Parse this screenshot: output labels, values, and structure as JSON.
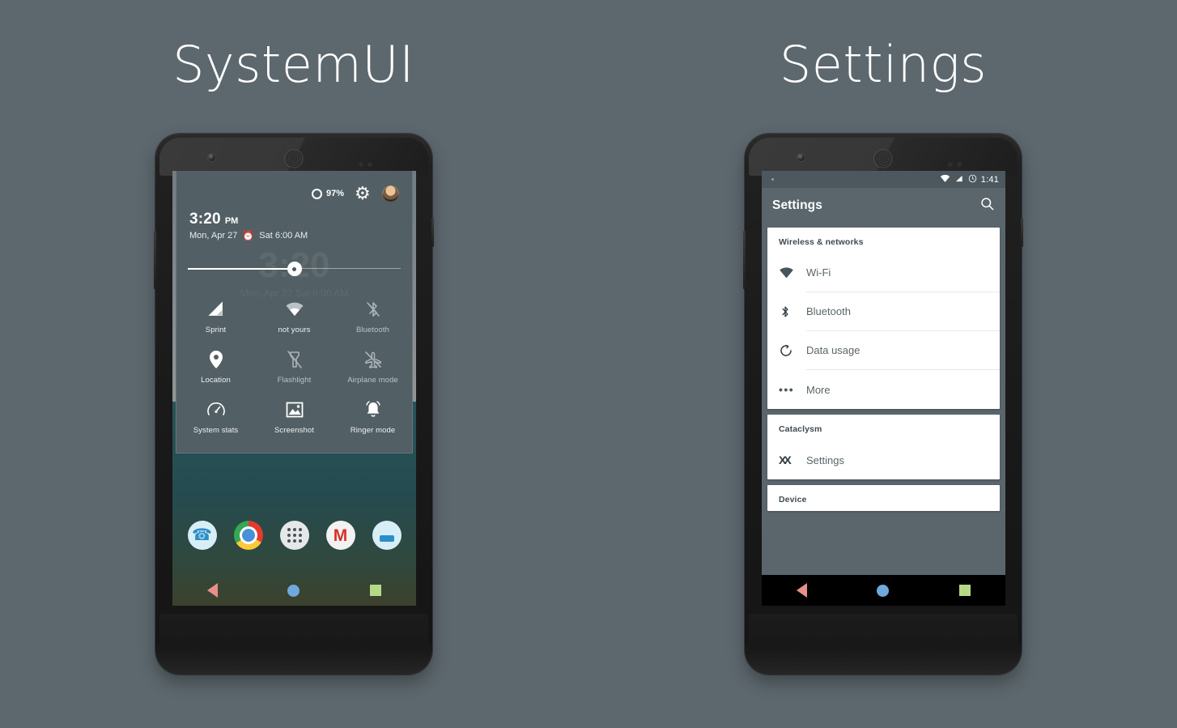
{
  "page": {
    "background_color": "#5d686e",
    "titles": {
      "left": "SystemUI",
      "right": "Settings"
    }
  },
  "systemui_phone": {
    "quick_settings": {
      "battery_percent": "97%",
      "battery_icon": "battery-circle-icon",
      "gear_icon": "gear-icon",
      "avatar_icon": "user-avatar",
      "time": "3:20",
      "am_pm": "PM",
      "date": "Mon, Apr 27",
      "alarm_icon": "alarm-clock-icon",
      "alarm_text": "Sat 6:00 AM",
      "brightness": {
        "label": "brightness-slider",
        "value_percent": 50
      },
      "ghost_time": "3:20",
      "ghost_date": "Mon, Apr 27  Sat 6:00 AM",
      "tiles": [
        {
          "label": "Sprint",
          "icon": "cell-signal-icon",
          "state": "on"
        },
        {
          "label": "not yours",
          "icon": "wifi-icon",
          "state": "on"
        },
        {
          "label": "Bluetooth",
          "icon": "bluetooth-off-icon",
          "state": "off"
        },
        {
          "label": "Location",
          "icon": "location-pin-icon",
          "state": "on"
        },
        {
          "label": "Flashlight",
          "icon": "flashlight-off-icon",
          "state": "off"
        },
        {
          "label": "Airplane mode",
          "icon": "airplane-off-icon",
          "state": "off"
        },
        {
          "label": "System stats",
          "icon": "speedometer-icon",
          "state": "on"
        },
        {
          "label": "Screenshot",
          "icon": "image-icon",
          "state": "on"
        },
        {
          "label": "Ringer mode",
          "icon": "bell-ring-icon",
          "state": "on"
        }
      ]
    },
    "dock": [
      {
        "name": "phone-app-icon",
        "label": "Phone"
      },
      {
        "name": "chrome-app-icon",
        "label": "Chrome"
      },
      {
        "name": "app-drawer-icon",
        "label": "Apps"
      },
      {
        "name": "gmail-app-icon",
        "label": "Gmail"
      },
      {
        "name": "messaging-app-icon",
        "label": "Messaging"
      }
    ],
    "navbar": {
      "back_icon": "back-triangle-icon",
      "home_icon": "home-circle-icon",
      "recents_icon": "recents-square-icon",
      "back_color": "#e88f8b",
      "home_color": "#6fa8dc",
      "recents_color": "#b6d987"
    }
  },
  "settings_phone": {
    "statusbar": {
      "wifi_icon": "wifi-icon",
      "signal_icon": "cell-signal-icon",
      "alarm_icon": "clock-icon",
      "clock": "1:41"
    },
    "actionbar": {
      "title": "Settings",
      "search_icon": "search-icon"
    },
    "sections": [
      {
        "header": "Wireless & networks",
        "rows": [
          {
            "label": "Wi-Fi",
            "icon": "wifi-icon"
          },
          {
            "label": "Bluetooth",
            "icon": "bluetooth-icon"
          },
          {
            "label": "Data usage",
            "icon": "data-usage-icon"
          },
          {
            "label": "More",
            "icon": "more-dots-icon"
          }
        ]
      },
      {
        "header": "Cataclysm",
        "rows": [
          {
            "label": "Settings",
            "icon": "cataclysm-icon"
          }
        ]
      },
      {
        "header": "Device",
        "rows": []
      }
    ],
    "navbar": {
      "back_icon": "back-triangle-icon",
      "home_icon": "home-circle-icon",
      "recents_icon": "recents-square-icon",
      "back_color": "#e88f8b",
      "home_color": "#6fa8dc",
      "recents_color": "#b6d987"
    }
  }
}
